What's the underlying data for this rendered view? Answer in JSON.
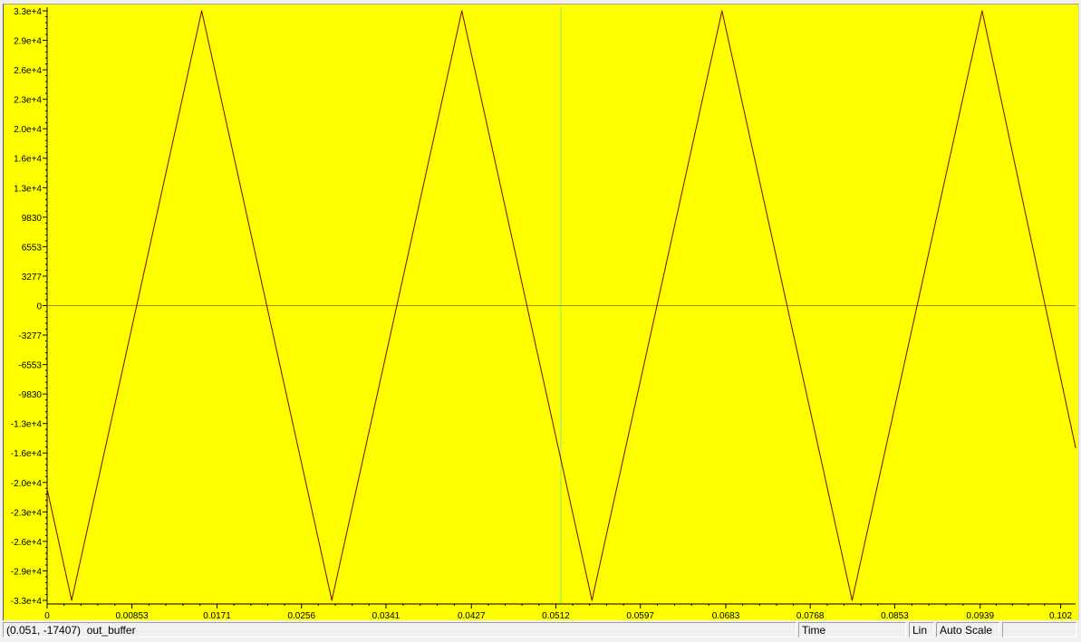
{
  "chart_data": {
    "type": "line",
    "background_color": "#ffff00",
    "line_color": "#800000",
    "cursor_color": "#00e0e0",
    "zero_line_color": "#a09000",
    "grid": false,
    "xlim": [
      0,
      0.1035
    ],
    "ylim": [
      -32768,
      32767
    ],
    "x_ticks": [
      0,
      0.00853,
      0.0171,
      0.0256,
      0.0341,
      0.0427,
      0.0512,
      0.0597,
      0.0683,
      0.0768,
      0.0853,
      0.0939,
      0.102
    ],
    "x_tick_labels": [
      "0",
      "0.00853",
      "0.0171",
      "0.0256",
      "0.0341",
      "0.0427",
      "0.0512",
      "0.0597",
      "0.0683",
      "0.0768",
      "0.0853",
      "0.0939",
      "0.102"
    ],
    "y_ticks": [
      32767,
      29491,
      26214,
      22938,
      19661,
      16384,
      13107,
      9830,
      6553,
      3277,
      0,
      -3277,
      -6553,
      -9830,
      -13107,
      -16384,
      -19661,
      -22938,
      -26214,
      -29491,
      -32768
    ],
    "y_tick_labels": [
      "3.3e+4",
      "2.9e+4",
      "2.6e+4",
      "2.3e+4",
      "2.0e+4",
      "1.6e+4",
      "1.3e+4",
      "9830",
      "6553",
      "3277",
      "0",
      "-3277",
      "-6553",
      "-9830",
      "-1.3e+4",
      "-1.6e+4",
      "-2.0e+4",
      "-2.3e+4",
      "-2.6e+4",
      "-2.9e+4",
      "-3.3e+4"
    ],
    "cursor_x": 0.0517,
    "series": [
      {
        "x": [
          0,
          0.00247,
          0.01556,
          0.02865,
          0.04174,
          0.05483,
          0.06792,
          0.08101,
          0.0941,
          0.1035
        ],
        "y": [
          -20394,
          -32768,
          32767,
          -32768,
          32767,
          -32768,
          32767,
          -32768,
          32767,
          -15800
        ]
      }
    ]
  },
  "status": {
    "cursor_readout": "(0.051, -17407)",
    "signal_name": "out_buffer",
    "axis_mode": "Time",
    "scale_type": "Lin",
    "scale_mode": "Auto Scale",
    "extra": ""
  }
}
